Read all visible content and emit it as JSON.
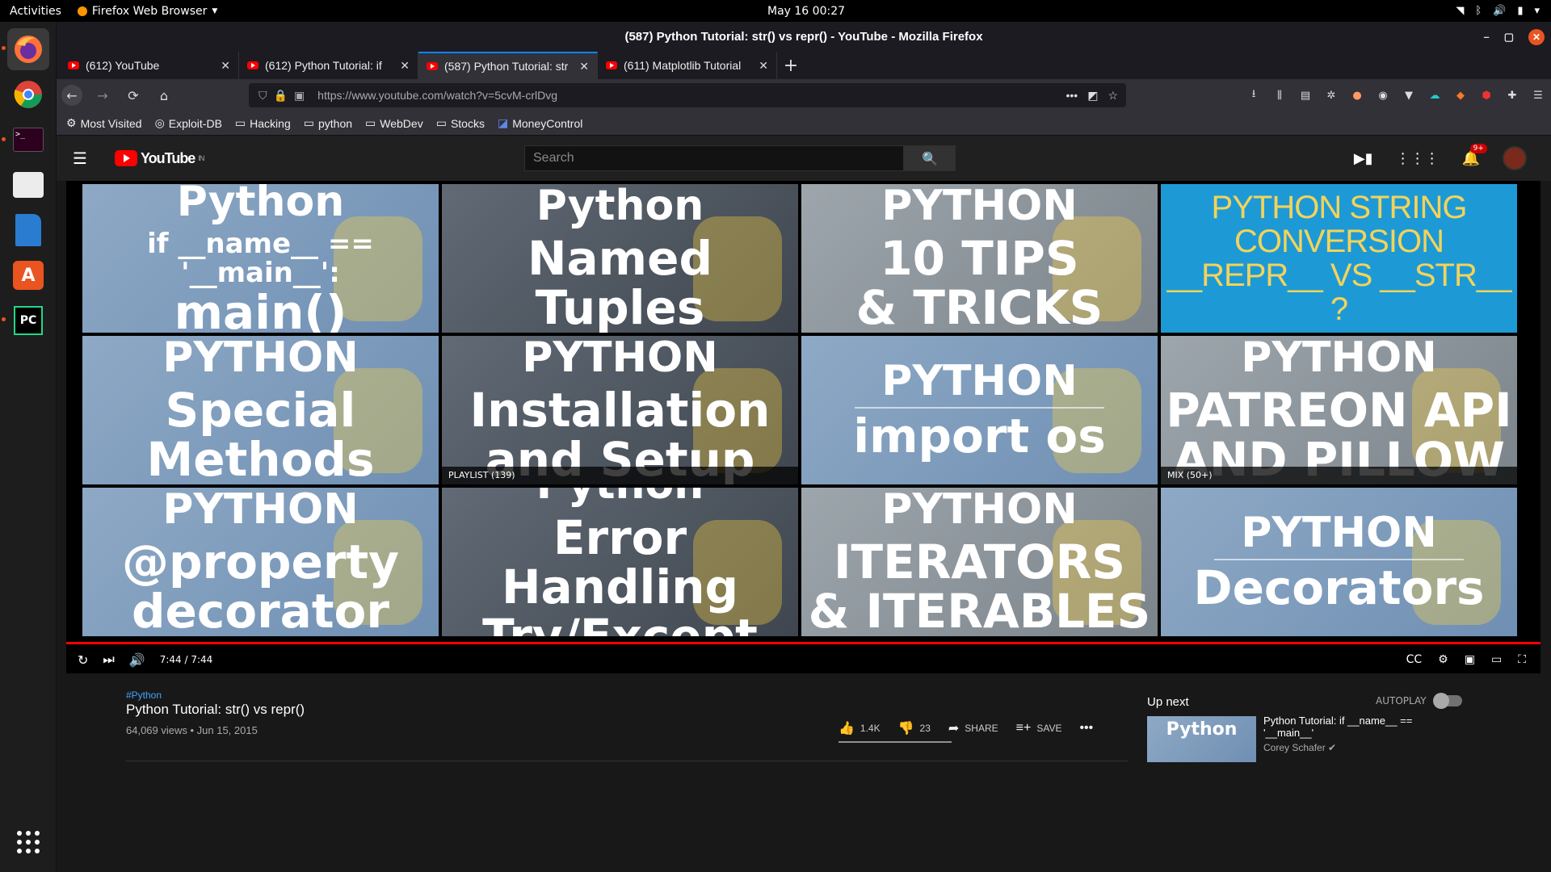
{
  "system": {
    "activities": "Activities",
    "app_name": "Firefox Web Browser",
    "clock": "May 16  00:27"
  },
  "window": {
    "title": "(587) Python Tutorial: str() vs repr() - YouTube - Mozilla Firefox"
  },
  "tabs": [
    {
      "label": "(612) YouTube"
    },
    {
      "label": "(612) Python Tutorial: if"
    },
    {
      "label": "(587) Python Tutorial: str"
    },
    {
      "label": "(611) Matplotlib Tutorial"
    }
  ],
  "url": {
    "value": "https://www.youtube.com/watch?v=5cvM-crlDvg"
  },
  "bookmarks": [
    "Most Visited",
    "Exploit-DB",
    "Hacking",
    "python",
    "WebDev",
    "Stocks",
    "MoneyControl"
  ],
  "youtube": {
    "logo_text": "YouTube",
    "region": "IN",
    "search_placeholder": "Search",
    "notif_count": "9+"
  },
  "endscreen": [
    {
      "lines": [
        "Python",
        "if __name__ == '__main__':",
        "main()"
      ],
      "style": "blue"
    },
    {
      "lines": [
        "Python",
        "Named Tuples"
      ],
      "style": "grey"
    },
    {
      "lines": [
        "PYTHON",
        "10 TIPS",
        "& TRICKS"
      ],
      "style": "lgrey"
    },
    {
      "lines": [
        "PYTHON STRING CONVERSION",
        "__REPR__ VS __STR__ ?"
      ],
      "style": "cyan"
    },
    {
      "lines": [
        "PYTHON",
        "Special",
        "Methods"
      ],
      "style": "blue"
    },
    {
      "lines": [
        "PYTHON",
        "Installation",
        "and Setup"
      ],
      "style": "grey",
      "overlay": "PLAYLIST (139)"
    },
    {
      "lines": [
        "PYTHON",
        "import os"
      ],
      "style": "blue"
    },
    {
      "lines": [
        "PYTHON",
        "PATREON API",
        "AND PILLOW"
      ],
      "style": "lgrey",
      "overlay": "MIX (50+)"
    },
    {
      "lines": [
        "PYTHON",
        "@property",
        "decorator"
      ],
      "style": "blue"
    },
    {
      "lines": [
        "Python",
        "Error Handling",
        "Try/Except"
      ],
      "style": "grey"
    },
    {
      "lines": [
        "PYTHON",
        "ITERATORS",
        "& ITERABLES"
      ],
      "style": "lgrey"
    },
    {
      "lines": [
        "PYTHON",
        "Decorators"
      ],
      "style": "blue"
    }
  ],
  "player": {
    "time": "7:44 / 7:44",
    "progress_fraction": 1.0
  },
  "video": {
    "hashtag": "#Python",
    "title": "Python Tutorial: str() vs repr()",
    "meta": "64,069 views • Jun 15, 2015",
    "likes": "1.4K",
    "dislikes": "23",
    "share": "SHARE",
    "save": "SAVE"
  },
  "sidebar": {
    "up_next": "Up next",
    "autoplay": "AUTOPLAY",
    "next_thumb": "Python",
    "next_title": "Python Tutorial: if __name__ == '__main__'",
    "next_channel": "Corey Schafer"
  },
  "colors": {
    "accent_red": "#ff0000",
    "link_blue": "#3ea6ff",
    "ubuntu_orange": "#e95420"
  }
}
